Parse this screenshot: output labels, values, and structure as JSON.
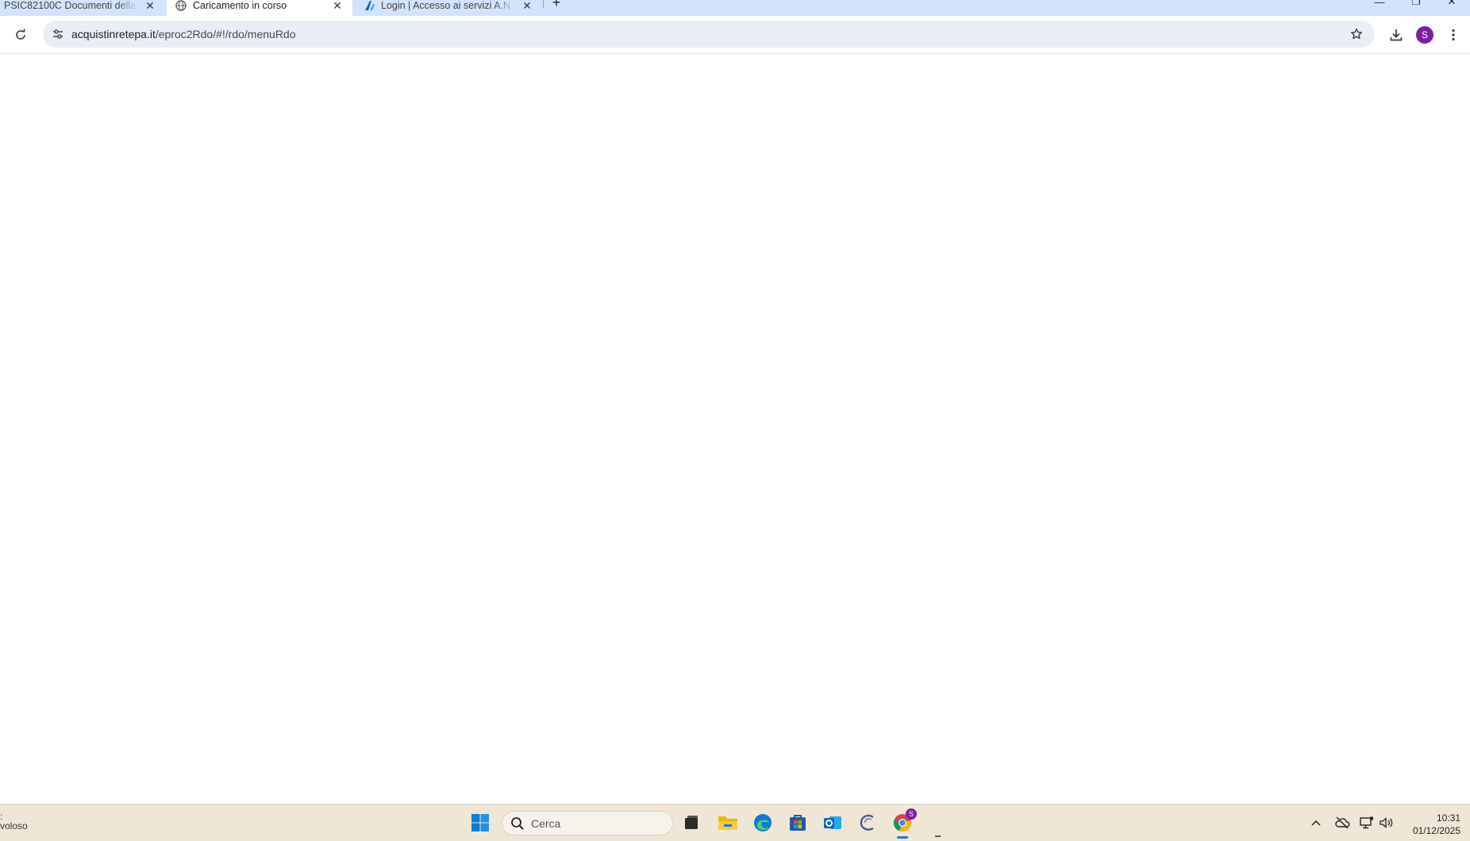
{
  "browser": {
    "tabs": [
      {
        "title": "PSIC82100C Documenti della pi",
        "active": false
      },
      {
        "title": "Caricamento in corso",
        "active": true
      },
      {
        "title": "Login | Accesso ai servizi A.N.AC",
        "active": false
      }
    ],
    "address": {
      "domain": "acquistinretepa.it",
      "path": "/eproc2Rdo/#!/rdo/menuRdo"
    },
    "profile_initial": "S"
  },
  "taskbar": {
    "weather_line1": ":",
    "weather_line2": "voloso",
    "search_placeholder": "Cerca",
    "chrome_badge": "S",
    "time": "10:31",
    "date": "01/12/2025"
  },
  "colors": {
    "tabstrip": "#d3e3fd",
    "omnibox": "#e9eef6",
    "taskbar": "#efe6d6",
    "accent": "#1a73e8",
    "profile": "#7b1fa2"
  }
}
